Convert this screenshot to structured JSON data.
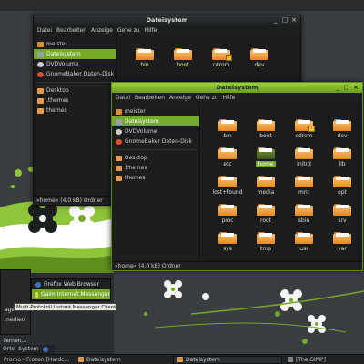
{
  "colors": {
    "accent": "#74a92a",
    "folder": "#e89a4a",
    "dark": "#1e2021"
  },
  "window_back": {
    "title": "Dateisystem",
    "menu": [
      "Datei",
      "Bearbeiten",
      "Anzeige",
      "Gehe zu",
      "Hilfe"
    ],
    "sidebar": [
      {
        "label": "meister",
        "icon": "home-icon"
      },
      {
        "label": "Dateisystem",
        "icon": "harddisk-icon",
        "selected": true
      },
      {
        "label": "DVDVolume",
        "icon": "dvd-icon"
      },
      {
        "label": "GnomeBaker Daten-Disk",
        "icon": "gnomebaker-icon"
      },
      {
        "label": "Desktop",
        "icon": "folder-icon"
      },
      {
        "label": ".themes",
        "icon": "folder-icon"
      },
      {
        "label": "themes",
        "icon": "folder-icon"
      }
    ],
    "files": [
      "bin",
      "boot",
      "cdrom",
      "dev"
    ],
    "status": "»home« (4,0 kB) Ordner"
  },
  "window_front": {
    "title": "Dateisystem",
    "menu": [
      "Datei",
      "Bearbeiten",
      "Anzeige",
      "Gehe zu",
      "Hilfe"
    ],
    "sidebar": [
      {
        "label": "meister",
        "icon": "home-icon"
      },
      {
        "label": "Dateisystem",
        "icon": "harddisk-icon",
        "selected": true
      },
      {
        "label": "DVDVolume",
        "icon": "dvd-icon"
      },
      {
        "label": "GnomeBaker Daten-Disk",
        "icon": "gnomebaker-icon"
      },
      {
        "label": "Desktop",
        "icon": "folder-icon"
      },
      {
        "label": ".themes",
        "icon": "folder-icon"
      },
      {
        "label": "themes",
        "icon": "folder-icon"
      }
    ],
    "files": [
      "bin",
      "boot",
      "cdrom",
      "dev",
      "etc",
      "home",
      "initrd",
      "lib",
      "lost+found",
      "media",
      "mnt",
      "opt",
      "proc",
      "root",
      "sbin",
      "srv",
      "sys",
      "tmp",
      "usr",
      "var"
    ],
    "selected_file": "home",
    "status": "»home« (4,0 kB) Ordner"
  },
  "app_menu": {
    "items": [
      "Firefox Web Browser",
      "Gaim Internet Messenger"
    ],
    "tooltip": "Multi-Protokoll Instant Messenger Client",
    "left_labels": [
      "age",
      "medien",
      "fernen..."
    ]
  },
  "top_panel": {
    "orte": "Orte",
    "system": "System"
  },
  "taskbar": {
    "items": [
      "Promo - Frozen [Hardc...",
      "Dateisystem",
      "Dateisystem",
      "[The GIMP]"
    ]
  }
}
